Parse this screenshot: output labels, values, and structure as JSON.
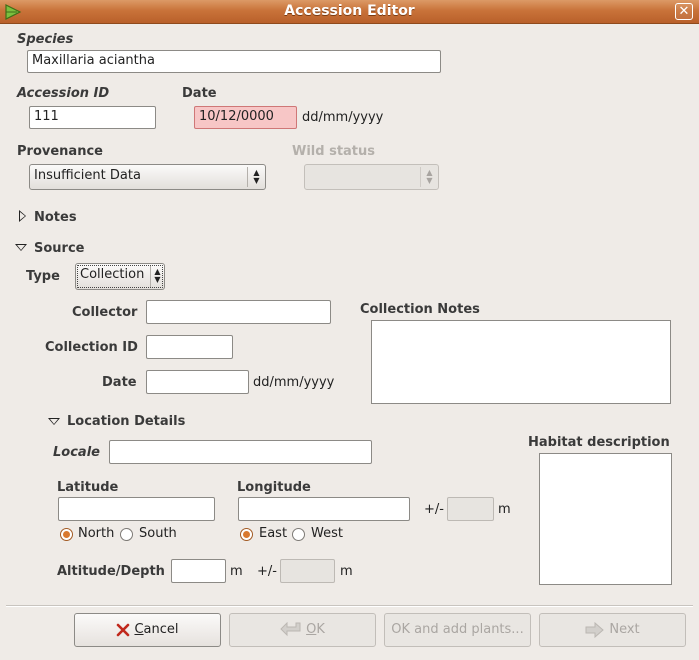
{
  "window": {
    "title": "Accession Editor",
    "close_glyph": "✕",
    "icon": "app-leaf-icon"
  },
  "species": {
    "label": "Species",
    "value": "Maxillaria aciantha"
  },
  "accession_id": {
    "label": "Accession ID",
    "value": "111"
  },
  "date": {
    "label": "Date",
    "value": "10/12/0000",
    "format_hint": "dd/mm/yyyy",
    "error_color": "#f7c6c6"
  },
  "provenance": {
    "label": "Provenance",
    "value": "Insufficient Data"
  },
  "wild_status": {
    "label": "Wild status",
    "value": ""
  },
  "notes": {
    "label": "Notes",
    "expanded": false
  },
  "source": {
    "label": "Source",
    "expanded": true,
    "type": {
      "label": "Type",
      "value": "Collection"
    },
    "collector": {
      "label": "Collector",
      "value": ""
    },
    "collection_id": {
      "label": "Collection ID",
      "value": ""
    },
    "date": {
      "label": "Date",
      "value": "",
      "format_hint": "dd/mm/yyyy"
    },
    "collection_notes": {
      "label": "Collection Notes",
      "value": ""
    }
  },
  "location": {
    "label": "Location Details",
    "expanded": true,
    "locale": {
      "label": "Locale",
      "value": ""
    },
    "habitat": {
      "label": "Habitat description",
      "value": ""
    },
    "latitude": {
      "label": "Latitude",
      "value": "",
      "north": "North",
      "south": "South",
      "selected": "North"
    },
    "longitude": {
      "label": "Longitude",
      "value": "",
      "east": "East",
      "west": "West",
      "selected": "East"
    },
    "geo_accuracy": {
      "plusminus": "+/-",
      "unit": "m",
      "value": ""
    },
    "altitude": {
      "label": "Altitude/Depth",
      "value": "",
      "unit": "m",
      "plusminus": "+/-",
      "accuracy_value": "",
      "accuracy_unit": "m"
    }
  },
  "buttons": {
    "cancel": {
      "label": "Cancel",
      "mnemonic": "C",
      "rest": "ancel",
      "icon": "cancel-x-icon"
    },
    "ok": {
      "label": "OK",
      "mnemonic": "O",
      "rest": "K",
      "icon": "ok-arrow-icon"
    },
    "ok_add": {
      "label": "OK and add plants..."
    },
    "next": {
      "label": "Next",
      "icon": "next-arrow-icon"
    }
  },
  "colors": {
    "titlebar": "#c9733a",
    "accent": "#d9792f",
    "background": "#efebe7"
  }
}
